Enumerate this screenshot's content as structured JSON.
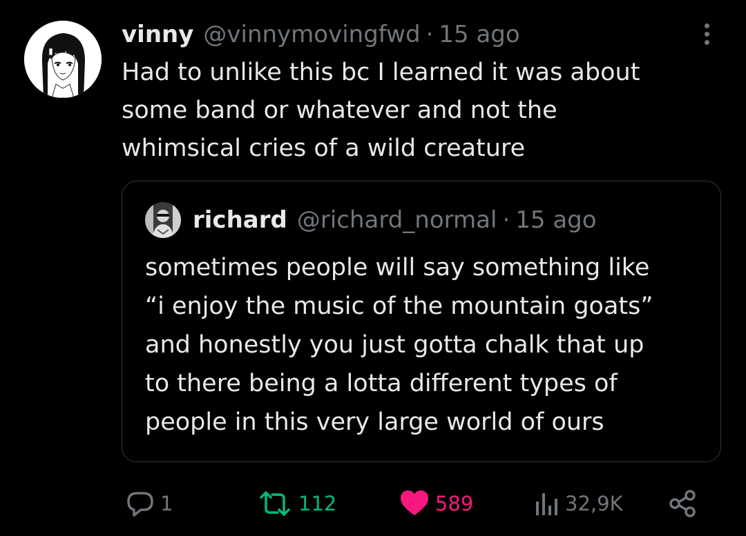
{
  "post": {
    "author": {
      "name": "vinny",
      "handle": "@vinnymovingfwd",
      "time": "15 ago",
      "avatar_icon": "anime-girl-avatar"
    },
    "separator": "·",
    "text_lines": [
      "Had to unlike this bc I learned it was about",
      "some band or whatever and not the",
      "whimsical cries of a wild creature"
    ],
    "more_icon": "more-options-icon"
  },
  "quoted_post": {
    "author": {
      "name": "richard",
      "handle": "@richard_normal",
      "time": "15 ago",
      "avatar_icon": "person-photo-avatar"
    },
    "text_lines": [
      "sometimes people will say something like",
      "“i enjoy the music of the mountain goats”",
      "and honestly you just gotta chalk that up",
      "to there being a lotta different types of",
      "people in this very large world of ours"
    ]
  },
  "actions": {
    "replies": "1",
    "reposts": "112",
    "likes": "589",
    "views": "32,9K"
  },
  "colors": {
    "background": "#000000",
    "text": "#e7e9ea",
    "secondary": "#71767b",
    "repost_green": "#00ba7c",
    "like_pink": "#f91880",
    "border": "#333639"
  }
}
